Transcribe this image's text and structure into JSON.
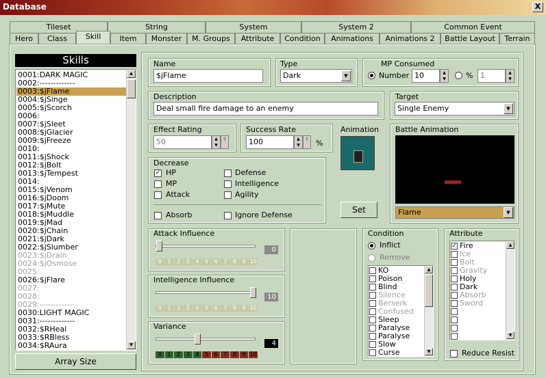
{
  "window": {
    "title": "Database",
    "close_glyph": "X"
  },
  "tabs_row1": [
    "Tileset",
    "String",
    "System",
    "System 2",
    "Common Event"
  ],
  "tabs_row2": [
    "Hero",
    "Class",
    "Skill",
    "Item",
    "Monster",
    "M. Groups",
    "Attribute",
    "Condition",
    "Animations",
    "Animations 2",
    "Battle Layout",
    "Terrain"
  ],
  "skills": {
    "header": "Skills",
    "array_size_label": "Array Size",
    "items": [
      "0001:DARK MAGIC",
      "0002:-------------",
      "0003:$jFlame",
      "0004:$jSinge",
      "0005:$jScorch",
      "0006:",
      "0007:$jSleet",
      "0008:$jGlacier",
      "0009:$jFreeze",
      "0010:",
      "0011:$jShock",
      "0012:$jBolt",
      "0013:$jTempest",
      "0014:",
      "0015:$jVenom",
      "0016:$jDoom",
      "0017:$jMute",
      "0018:$jMuddle",
      "0019:$jMad",
      "0020:$jChain",
      "0021:$jDark",
      "0022:$jSlumber",
      "0023:$jDrain",
      "0024:$jOsmose",
      "0025:",
      "0026:$jFlare",
      "0027:",
      "0028:",
      "0029:-------------",
      "0030:LIGHT MAGIC",
      "0031:-------------",
      "0032:$RHeal",
      "0033:$RBless",
      "0034:$RAura"
    ]
  },
  "form": {
    "name_label": "Name",
    "name_value": "$jFlame",
    "type_label": "Type",
    "type_value": "Dark",
    "mp_label": "MP Consumed",
    "mp_number_label": "Number",
    "mp_number_value": "10",
    "mp_percent_label": "%",
    "mp_percent_value": "1",
    "desc_label": "Description",
    "desc_value": "Deal small fire damage to an enemy",
    "target_label": "Target",
    "target_value": "Single Enemy",
    "effect_label": "Effect Rating",
    "effect_value": "50",
    "success_label": "Success Rate",
    "success_value": "100",
    "success_unit": "%",
    "animation_label": "Animation",
    "set_label": "Set",
    "battle_anim_label": "Battle Animation",
    "battle_anim_value": "Flame",
    "decrease_label": "Decrease",
    "hp": "HP",
    "mp": "MP",
    "attack": "Attack",
    "defense": "Defense",
    "intelligence": "Intelligence",
    "agility": "Agility",
    "absorb": "Absorb",
    "ignore_defense": "Ignore Defense",
    "attack_infl_label": "Attack Influence",
    "attack_infl_value": "0",
    "int_infl_label": "Intelligence Influence",
    "int_infl_value": "10",
    "variance_label": "Variance",
    "variance_value": "4",
    "scale": [
      "0",
      "1",
      "2",
      "3",
      "4",
      "5",
      "6",
      "7",
      "8",
      "9",
      "10"
    ],
    "condition_label": "Condition",
    "inflict_label": "Inflict",
    "remove_label": "Remove",
    "conditions": [
      "KO",
      "Poison",
      "Blind",
      "Silence",
      "Berserk",
      "Confused",
      "Sleep",
      "Paralyse",
      "Paralyse",
      "Slow",
      "Curse"
    ],
    "attribute_label": "Attribute",
    "attributes": [
      "Fire",
      "Ice",
      "Bolt",
      "Gravity",
      "Holy",
      "Dark",
      "Absorb",
      "Sword",
      "",
      "",
      "",
      "",
      ""
    ],
    "reduce_resist_label": "Reduce Resist"
  },
  "colors": {
    "selected": "#c8a050",
    "panel": "#c8d8c0"
  }
}
